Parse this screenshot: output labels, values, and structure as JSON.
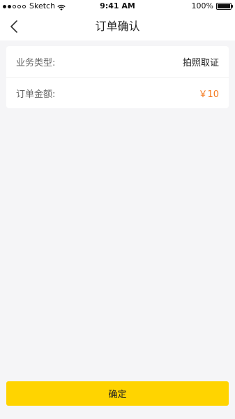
{
  "status_bar": {
    "carrier": "Sketch",
    "time": "9:41 AM",
    "battery": "100%",
    "signal_icon": "signal-dots-icon",
    "wifi_icon": "wifi-icon",
    "battery_icon": "battery-icon"
  },
  "nav": {
    "title": "订单确认",
    "back_icon": "chevron-left-icon"
  },
  "order": {
    "rows": [
      {
        "label": "业务类型:",
        "value": "拍照取证"
      },
      {
        "label": "订单金额:",
        "value": "￥10"
      }
    ]
  },
  "footer": {
    "confirm_label": "确定"
  },
  "colors": {
    "accent": "#ffd400",
    "amount": "#f47a1f",
    "background": "#f5f5f7"
  }
}
